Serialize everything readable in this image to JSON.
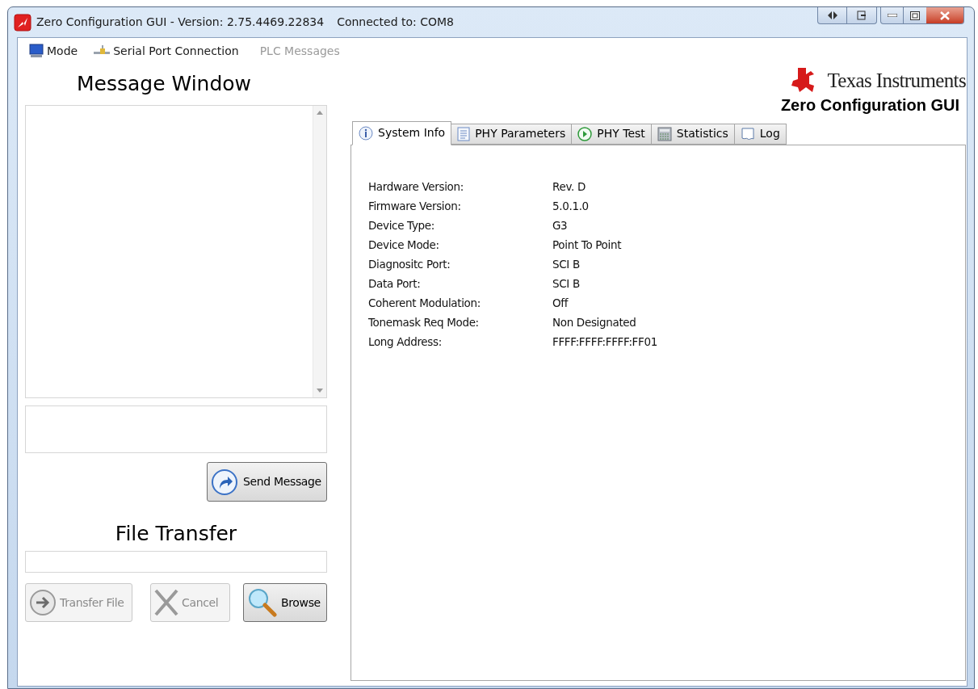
{
  "window": {
    "title": "Zero Configuration GUI - Version: 2.75.4469.22834",
    "connection": "Connected to: COM8"
  },
  "menu": [
    {
      "kind": "monitor",
      "label": "Mode",
      "disabled": false
    },
    {
      "kind": "plug",
      "label": "Serial Port Connection",
      "disabled": false
    },
    {
      "kind": "none",
      "label": "PLC Messages",
      "disabled": true
    }
  ],
  "message_panel": {
    "heading": "Message Window",
    "send_button": {
      "label": "Send Message",
      "disabled": false
    }
  },
  "file_transfer": {
    "heading": "File Transfer",
    "buttons": [
      {
        "kind": "arrow",
        "label": "Transfer File",
        "disabled": true
      },
      {
        "kind": "cross",
        "label": "Cancel",
        "disabled": true
      },
      {
        "kind": "magnifier",
        "label": "Browse",
        "disabled": false
      }
    ]
  },
  "logo": {
    "brand": "Texas Instruments",
    "subtitle": "Zero Configuration GUI"
  },
  "tabs": [
    {
      "kind": "info",
      "label": "System Info",
      "selected": true
    },
    {
      "kind": "document",
      "label": "PHY Parameters",
      "selected": false
    },
    {
      "kind": "play",
      "label": "PHY Test",
      "selected": false
    },
    {
      "kind": "calculator",
      "label": "Statistics",
      "selected": false
    },
    {
      "kind": "page",
      "label": "Log",
      "selected": false
    }
  ],
  "system_info": [
    {
      "label": "Hardware Version:",
      "value": "Rev. D"
    },
    {
      "label": "Firmware Version:",
      "value": "5.0.1.0"
    },
    {
      "label": "Device Type:",
      "value": "G3"
    },
    {
      "label": "Device Mode:",
      "value": "Point To Point"
    },
    {
      "label": "Diagnositc Port:",
      "value": "SCI B"
    },
    {
      "label": "Data Port:",
      "value": "SCI B"
    },
    {
      "label": "Coherent Modulation:",
      "value": "Off"
    },
    {
      "label": "Tonemask Req Mode:",
      "value": "Non Designated"
    },
    {
      "label": "Long Address:",
      "value": "FFFF:FFFF:FFFF:FF01"
    }
  ]
}
